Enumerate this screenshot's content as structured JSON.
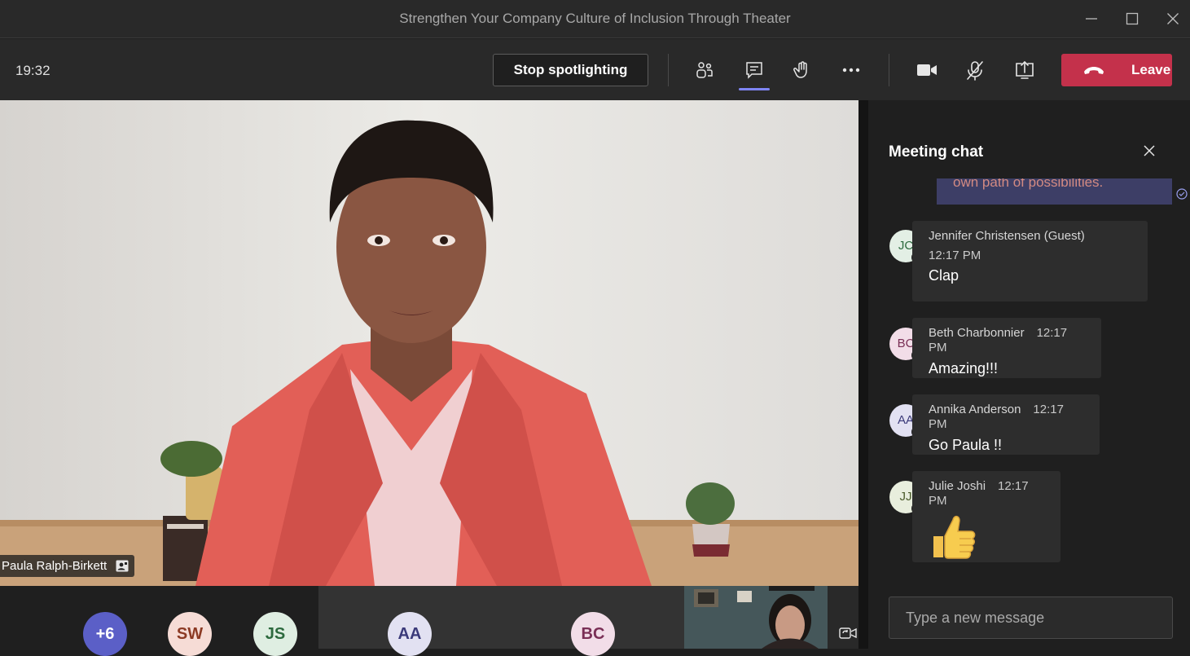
{
  "window": {
    "title": "Strengthen Your Company Culture of Inclusion Through Theater"
  },
  "toolbar": {
    "clock": "19:32",
    "stop_spotlight_label": "Stop spotlighting",
    "leave_label": "Leave",
    "icons": [
      "people-icon",
      "chat-icon",
      "raise-hand-icon",
      "more-icon",
      "camera-icon",
      "mic-off-icon",
      "share-icon"
    ]
  },
  "main_video": {
    "participant_name": "Paula Ralph-Birkett"
  },
  "strip": {
    "overflow_count": "+6",
    "avatars": [
      {
        "initials": "SW",
        "bg": "#f6dcd6",
        "fg": "#8c3a24"
      },
      {
        "initials": "JS",
        "bg": "#dfeee2",
        "fg": "#2d6a3e"
      },
      {
        "initials": "AA",
        "bg": "#e2e1f2",
        "fg": "#3b3a7a"
      },
      {
        "initials": "BC",
        "bg": "#f2dde8",
        "fg": "#7a2f56"
      }
    ]
  },
  "chat": {
    "title": "Meeting chat",
    "previous_message_fragment": "own path of possibilities.",
    "messages": [
      {
        "initials": "JC",
        "sender": "Jennifer Christensen (Guest)",
        "time": "12:17 PM",
        "body": "Clap",
        "avatar_bg": "#e3efe5",
        "avatar_fg": "#2d6a3e"
      },
      {
        "initials": "BC",
        "sender": "Beth Charbonnier",
        "time": "12:17 PM",
        "body": "Amazing!!!",
        "avatar_bg": "#f2dde8",
        "avatar_fg": "#7a2f56"
      },
      {
        "initials": "AA",
        "sender": "Annika Anderson",
        "time": "12:17 PM",
        "body": "Go Paula !!",
        "avatar_bg": "#e2e1f2",
        "avatar_fg": "#3b3a7a"
      },
      {
        "initials": "JJ",
        "sender": "Julie Joshi",
        "time": "12:17 PM",
        "body": "thumbs-up-emoji",
        "avatar_bg": "#e8eedd",
        "avatar_fg": "#4a5a2a"
      }
    ],
    "composer_placeholder": "Type a new message"
  },
  "colors": {
    "accent": "#7f85f5",
    "leave": "#c4314b",
    "panel": "#1f1f1f"
  }
}
